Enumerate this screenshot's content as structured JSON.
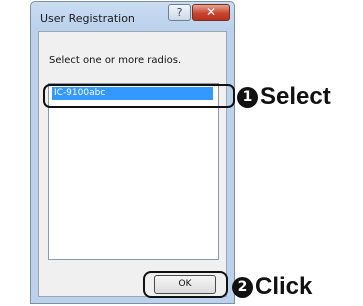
{
  "window": {
    "title": "User Registration",
    "help_label": "?",
    "close_label": "✕"
  },
  "dialog": {
    "prompt": "Select one or more radios.",
    "list_items": [
      {
        "label": "IC-9100abc",
        "selected": true
      }
    ],
    "ok_label": "OK"
  },
  "annotations": [
    {
      "number": "1",
      "label": "Select"
    },
    {
      "number": "2",
      "label": "Click"
    }
  ],
  "colors": {
    "selection": "#3399ff",
    "titlebar": "#bcd2ec",
    "close_button": "#c7452f"
  }
}
